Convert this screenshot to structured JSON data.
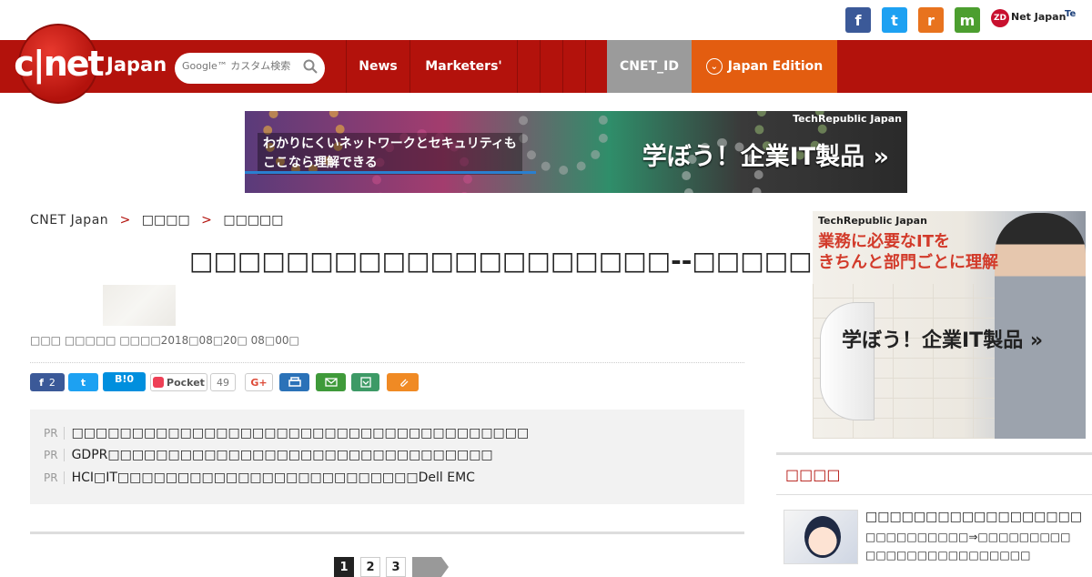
{
  "header": {
    "social": {
      "facebook": "f",
      "twitter": "t",
      "rss": "r",
      "mail": "m"
    },
    "partner_zdnet": "Net Japan",
    "partner_zdnet_badge": "ZD",
    "partner_tr": "Te"
  },
  "nav": {
    "logo": "c|net",
    "logo_sub": "Japan",
    "search_placeholder": "Google™ カスタム検索",
    "items": [
      "News",
      "Marketers'",
      "",
      "",
      "",
      ""
    ],
    "cnet_id": "CNET_ID",
    "edition": "Japan Edition"
  },
  "banner": {
    "brand": "TechRepublic Japan",
    "line1": "わかりにくいネットワークとセキュリティも",
    "line2": "ここなら理解できる",
    "cta": "学ぼう！企業IT製品 »"
  },
  "breadcrumb": {
    "home": "CNET Japan",
    "sep": ">",
    "level1": "□□□□",
    "level2": "□□□□□"
  },
  "article": {
    "title": "□□□□□□□□□□□□□□□□□□□□--□□□□□□□□□□□□□□□□",
    "byline": "□□□ □□□□□ □□□□2018□08□20□ 08□00□"
  },
  "share": {
    "fb_count": "2",
    "hatena": "B!0",
    "pocket": "Pocket",
    "pocket_count": "49",
    "gplus": "G+"
  },
  "pr": {
    "tag": "PR",
    "items": [
      "□□□□□□□□□□□□□□□□□□□□□□□□□□□□□□□□□□□□□□",
      "GDPR□□□□□□□□□□□□□□□□□□□□□□□□□□□□□□□□",
      "HCI□IT□□□□□□□□□□□□□□□□□□□□□□□□□Dell EMC"
    ]
  },
  "pagination": {
    "pages": [
      "1",
      "2",
      "3"
    ]
  },
  "side_ad": {
    "brand": "TechRepublic Japan",
    "line1": "業務に必要なITを",
    "line2": "きちんと部門ごとに理解",
    "cta": "学ぼう！企業IT製品 »"
  },
  "popular": {
    "title": "□□□□",
    "headline": "□□□□□□□□□□□□□□□□□□",
    "sub1": "□□□□□□□□□□⇒□□□□□□□□□",
    "sub2": "□□□□□□□□□□□□□□□□"
  }
}
